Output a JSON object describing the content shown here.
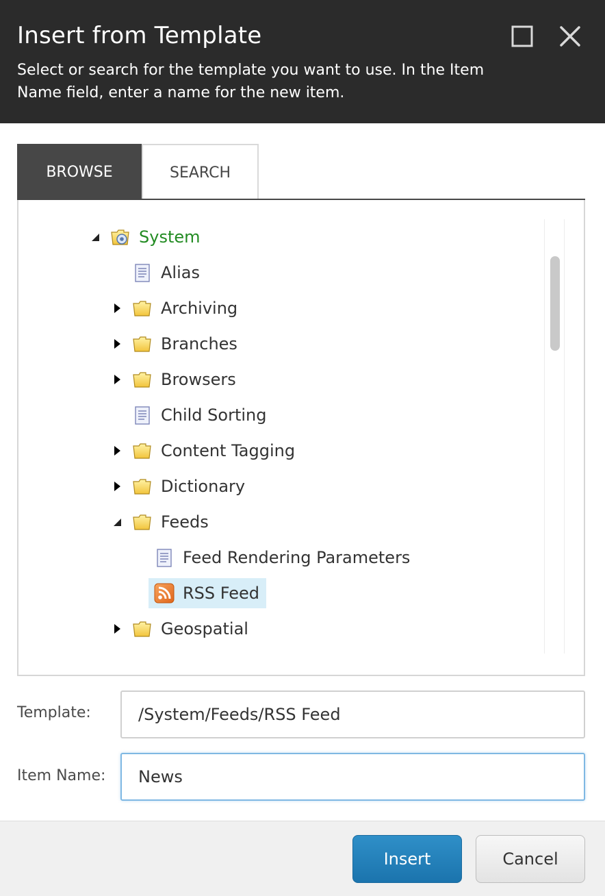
{
  "dialog": {
    "title": "Insert from Template",
    "description": "Select or search for the template you want to use. In the Item Name field, enter a name for the new item."
  },
  "tabs": [
    {
      "label": "BROWSE",
      "active": true
    },
    {
      "label": "SEARCH",
      "active": false
    }
  ],
  "tree": [
    {
      "label": "System",
      "icon": "system-folder-icon",
      "toggle": "expanded"
    },
    {
      "label": "Alias",
      "icon": "template-icon",
      "toggle": "none"
    },
    {
      "label": "Archiving",
      "icon": "folder-icon",
      "toggle": "collapsed"
    },
    {
      "label": "Branches",
      "icon": "folder-icon",
      "toggle": "collapsed"
    },
    {
      "label": "Browsers",
      "icon": "folder-icon",
      "toggle": "collapsed"
    },
    {
      "label": "Child Sorting",
      "icon": "template-icon",
      "toggle": "none"
    },
    {
      "label": "Content Tagging",
      "icon": "folder-icon",
      "toggle": "collapsed"
    },
    {
      "label": "Dictionary",
      "icon": "folder-icon",
      "toggle": "collapsed"
    },
    {
      "label": "Feeds",
      "icon": "folder-icon",
      "toggle": "expanded"
    },
    {
      "label": "Feed Rendering Parameters",
      "icon": "template-icon",
      "toggle": "none"
    },
    {
      "label": "RSS Feed",
      "icon": "rss-icon",
      "toggle": "none",
      "selected": true
    },
    {
      "label": "Geospatial",
      "icon": "folder-icon",
      "toggle": "collapsed"
    }
  ],
  "fields": {
    "template_label": "Template:",
    "template_value": "/System/Feeds/RSS Feed",
    "item_name_label": "Item Name:",
    "item_name_value": "News"
  },
  "buttons": {
    "insert": "Insert",
    "cancel": "Cancel"
  },
  "colors": {
    "header_bg": "#2b2b2b",
    "active_tab_bg": "#474747",
    "system_label": "#228b22",
    "selection_bg": "#d8eef8",
    "insert_button": "#1b74ad"
  }
}
